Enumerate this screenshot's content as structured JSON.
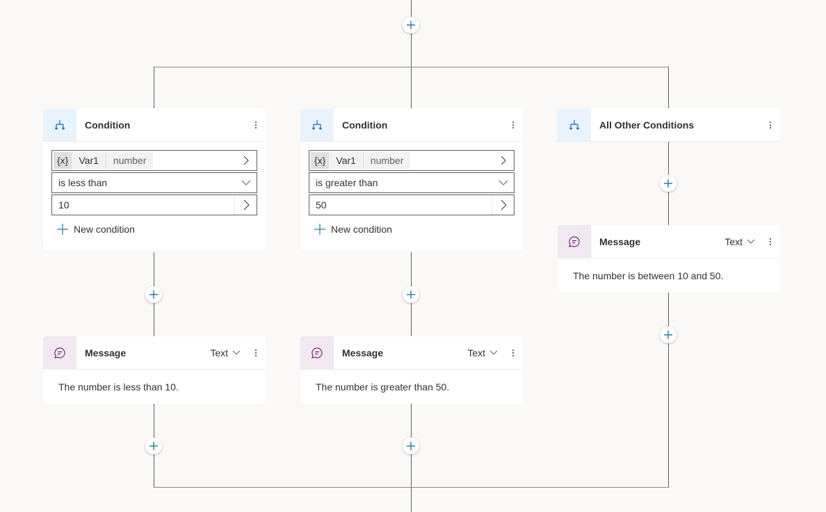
{
  "colors": {
    "background": "#faf9f8",
    "condition_icon_bg": "#e8f3fe",
    "condition_icon": "#0f6cbd",
    "message_icon_bg": "#f1e8f2",
    "message_icon": "#742774",
    "plus_icon": "#2b7a9b",
    "connector": "#605e5c"
  },
  "branches": [
    {
      "condition": {
        "title": "Condition",
        "variable": {
          "symbol": "{x}",
          "name": "Var1",
          "type": "number"
        },
        "operator": "is less than",
        "value": "10",
        "new_condition_label": "New condition"
      },
      "message": {
        "title": "Message",
        "type_label": "Text",
        "text": "The number is less than 10."
      }
    },
    {
      "condition": {
        "title": "Condition",
        "variable": {
          "symbol": "{x}",
          "name": "Var1",
          "type": "number"
        },
        "operator": "is greater than",
        "value": "50",
        "new_condition_label": "New condition"
      },
      "message": {
        "title": "Message",
        "type_label": "Text",
        "text": "The number is greater than 50."
      }
    },
    {
      "condition": {
        "title": "All Other Conditions"
      },
      "message": {
        "title": "Message",
        "type_label": "Text",
        "text": "The number is between 10 and 50."
      }
    }
  ]
}
